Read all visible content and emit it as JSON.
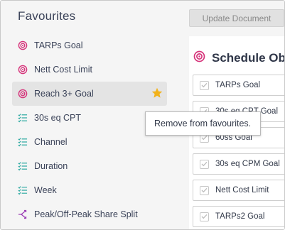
{
  "sidebar": {
    "title": "Favourites",
    "items": [
      {
        "label": "TARPs Goal",
        "icon": "target-icon"
      },
      {
        "label": "Nett Cost Limit",
        "icon": "target-icon"
      },
      {
        "label": "Reach 3+ Goal",
        "icon": "target-icon",
        "favourite": true
      },
      {
        "label": "30s eq CPT",
        "icon": "checklist-icon"
      },
      {
        "label": "Channel",
        "icon": "checklist-icon"
      },
      {
        "label": "Duration",
        "icon": "checklist-icon"
      },
      {
        "label": "Week",
        "icon": "checklist-icon"
      },
      {
        "label": "Peak/Off-Peak Share Split",
        "icon": "split-icon"
      }
    ]
  },
  "toolbar": {
    "update_label": "Update Document"
  },
  "panel": {
    "title": "Schedule Obj",
    "items": [
      {
        "label": "TARPs Goal"
      },
      {
        "label": "30s eq CPT Goal"
      },
      {
        "label": "60ss Goal"
      },
      {
        "label": "30s eq CPM Goal"
      },
      {
        "label": "Nett Cost Limit"
      },
      {
        "label": "TARPs2 Goal"
      }
    ]
  },
  "tooltip": {
    "text": "Remove from favourites."
  },
  "colors": {
    "target": "#d6337a",
    "checklist": "#2aa8a0",
    "split": "#9b3fb5",
    "star": "#f2b21b"
  }
}
